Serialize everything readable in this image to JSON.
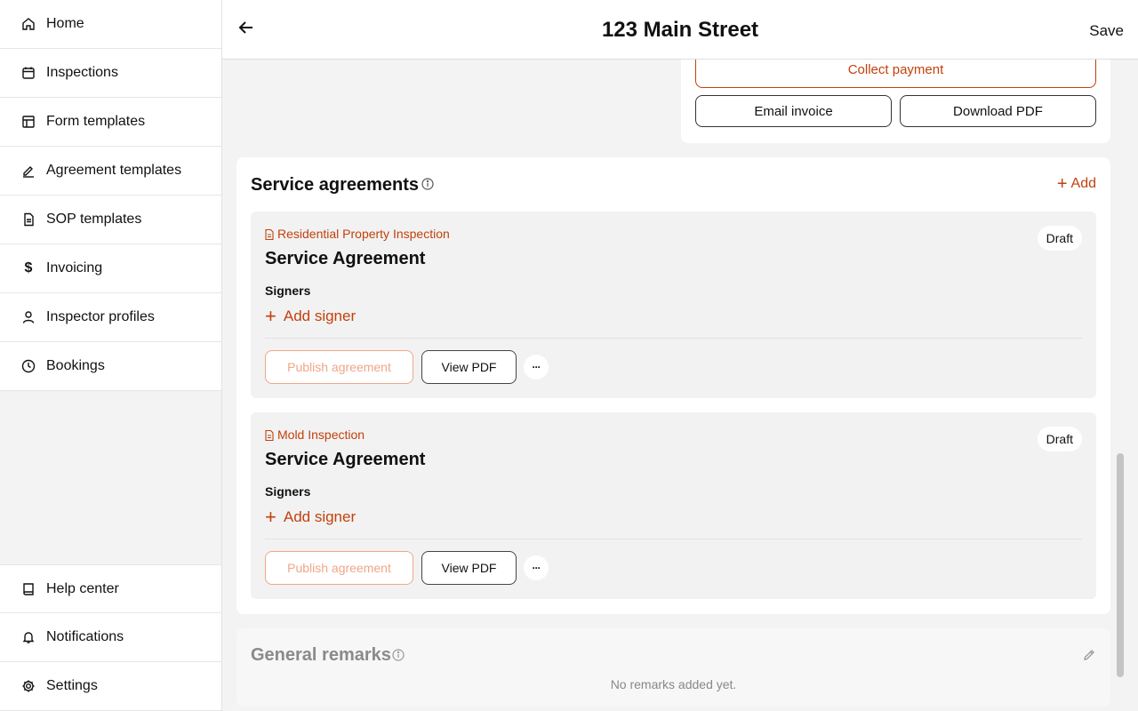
{
  "sidebar": {
    "items": [
      {
        "label": "Home",
        "icon": "home-icon"
      },
      {
        "label": "Inspections",
        "icon": "calendar-icon"
      },
      {
        "label": "Form templates",
        "icon": "layout-icon"
      },
      {
        "label": "Agreement templates",
        "icon": "signature-icon"
      },
      {
        "label": "SOP templates",
        "icon": "document-icon"
      },
      {
        "label": "Invoicing",
        "icon": "dollar-icon"
      },
      {
        "label": "Inspector profiles",
        "icon": "user-icon"
      },
      {
        "label": "Bookings",
        "icon": "clock-icon"
      }
    ],
    "bottom_items": [
      {
        "label": "Help center",
        "icon": "book-icon"
      },
      {
        "label": "Notifications",
        "icon": "bell-icon"
      },
      {
        "label": "Settings",
        "icon": "gear-icon"
      }
    ]
  },
  "header": {
    "title": "123 Main Street",
    "save_label": "Save",
    "back_icon": "arrow-left-icon"
  },
  "invoice": {
    "collect_label": "Collect payment",
    "email_label": "Email invoice",
    "download_label": "Download PDF"
  },
  "service_agreements": {
    "title": "Service agreements",
    "add_label": "Add",
    "signers_label": "Signers",
    "add_signer_label": "Add signer",
    "publish_label": "Publish agreement",
    "view_pdf_label": "View PDF",
    "more_label": "···",
    "items": [
      {
        "type": "Residential Property Inspection",
        "name": "Service Agreement",
        "status": "Draft"
      },
      {
        "type": "Mold Inspection",
        "name": "Service Agreement",
        "status": "Draft"
      }
    ]
  },
  "general_remarks": {
    "title": "General remarks",
    "empty_text": "No remarks added yet."
  },
  "colors": {
    "accent": "#c2410c",
    "accent_disabled": "#f0a688"
  }
}
